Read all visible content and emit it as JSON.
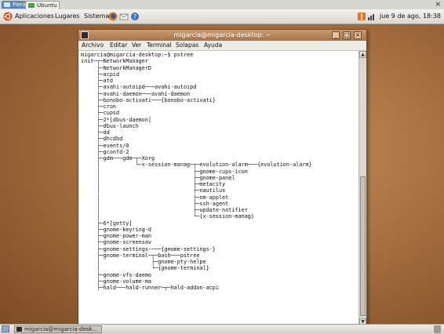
{
  "host": {
    "tabs": [
      "Fiera",
      "Ubuntu"
    ],
    "close_label": "×"
  },
  "panel": {
    "menus": [
      "Aplicaciones",
      "Lugares",
      "Sistema"
    ],
    "clock": "jue 9 de ago, 18:38"
  },
  "window": {
    "title": "migarcia@migarcia-desktop: ~",
    "buttons": {
      "minimize": "_",
      "maximize": "□",
      "close": "×"
    },
    "menu": [
      "Archivo",
      "Editar",
      "Ver",
      "Terminal",
      "Solapas",
      "Ayuda"
    ]
  },
  "terminal": {
    "lines": [
      "migarcia@migarcia-desktop:~$ pstree",
      "init─┬─NetworkManager",
      "     ├─NetworkManagerD",
      "     ├─acpid",
      "     ├─atd",
      "     ├─avahi-autoipd───avahi-autoipd",
      "     ├─avahi-daemon───avahi-daemon",
      "     ├─bonobo-activati───{bonobo-activati}",
      "     ├─cron",
      "     ├─cupsd",
      "     ├─2*[dbus-daemon]",
      "     ├─dbus-launch",
      "     ├─dd",
      "     ├─dhcdbd",
      "     ├─events/0",
      "     ├─gconfd-2",
      "     ├─gdm───gdm─┬─Xorg",
      "     │           └─x-session-manag─┬─evolution-alarm───{evolution-alarm}",
      "     │                             ├─gnome-cups-icon",
      "     │                             ├─gnome-panel",
      "     │                             ├─metacity",
      "     │                             ├─nautilus",
      "     │                             ├─nm-applet",
      "     │                             ├─ssh-agent",
      "     │                             ├─update-notifier",
      "     │                             └─{x-session-manag}",
      "     ├─6*[getty]",
      "     ├─gnome-keyring-d",
      "     ├─gnome-power-man",
      "     ├─gnome-screensav",
      "     ├─gnome-settings-───{gnome-settings-}",
      "     ├─gnome-terminal─┬─bash───pstree",
      "     │                ├─gnome-pty-helpe",
      "     │                └─{gnome-terminal}",
      "     ├─gnome-vfs-daemo",
      "     ├─gnome-volume-ma",
      "     ├─hald───hald-runner─┬─hald-addon-acpi"
    ]
  },
  "taskbar": {
    "task_label": "migarcia@migarcia-desk..."
  },
  "colors": {
    "titlebar": "#b5845a",
    "panel": "#e6e4dc",
    "desktop": "#a66f3f"
  }
}
